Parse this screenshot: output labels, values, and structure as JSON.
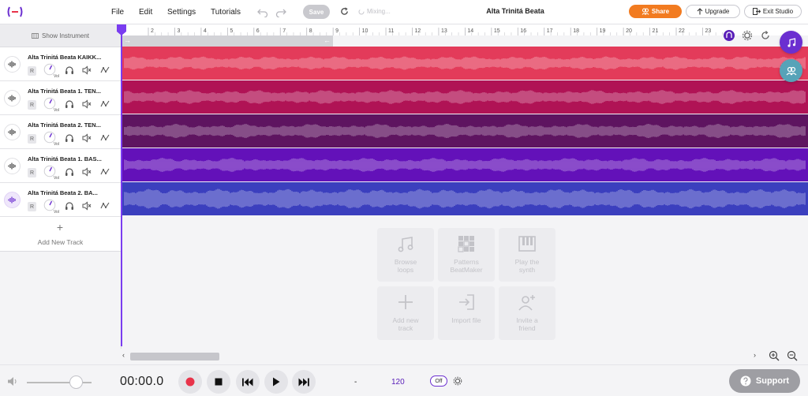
{
  "menu": {
    "file": "File",
    "edit": "Edit",
    "settings": "Settings",
    "tutorials": "Tutorials",
    "save_label": "Save",
    "mixing_label": "Mixing..."
  },
  "project": {
    "title": "Alta Trinitá Beata"
  },
  "header_buttons": {
    "share": "Share",
    "upgrade": "Upgrade",
    "exit": "Exit Studio"
  },
  "left_panel": {
    "show_instrument": "Show Instrument",
    "add_track": "Add New Track",
    "record_label": "R",
    "vol_label": "Vol"
  },
  "tracks": [
    {
      "name": "Alta Trinitá Beata KAIKK...",
      "color": "#e33b5a",
      "volume": 0.6,
      "selected": false
    },
    {
      "name": "Alta Trinitá Beata 1. TEN...",
      "color": "#b01355",
      "volume": 0.6,
      "selected": false
    },
    {
      "name": "Alta Trinitá Beata 2. TEN...",
      "color": "#5e1460",
      "volume": 0.6,
      "selected": false
    },
    {
      "name": "Alta Trinitá Beata 1. BAS...",
      "color": "#6311b9",
      "volume": 0.6,
      "selected": false
    },
    {
      "name": "Alta Trinitá Beata 2. BA...",
      "color": "#3b3fbe",
      "volume": 0.6,
      "selected": true
    }
  ],
  "ruler": {
    "labels": [
      "2",
      "3",
      "4",
      "5",
      "6",
      "7",
      "8",
      "9",
      "10",
      "11",
      "12",
      "13",
      "14",
      "15",
      "16",
      "17",
      "18",
      "19",
      "20",
      "21",
      "22",
      "23"
    ]
  },
  "empty_actions": [
    {
      "line1": "Browse",
      "line2": "loops",
      "icon": "music-note-icon"
    },
    {
      "line1": "Patterns",
      "line2": "BeatMaker",
      "icon": "patterns-grid-icon"
    },
    {
      "line1": "Play the",
      "line2": "synth",
      "icon": "piano-keys-icon"
    },
    {
      "line1": "Add new",
      "line2": "track",
      "icon": "plus-icon"
    },
    {
      "line1": "Import file",
      "line2": "",
      "icon": "import-icon"
    },
    {
      "line1": "Invite a",
      "line2": "friend",
      "icon": "invite-user-icon"
    }
  ],
  "transport": {
    "time": "00:00.0",
    "key": "-",
    "bpm": "120",
    "metronome": "Off",
    "master_volume": 0.75
  },
  "support": {
    "label": "Support"
  },
  "colors": {
    "accent": "#6b2fd0",
    "share": "#f27b20",
    "record": "#e8334a"
  }
}
